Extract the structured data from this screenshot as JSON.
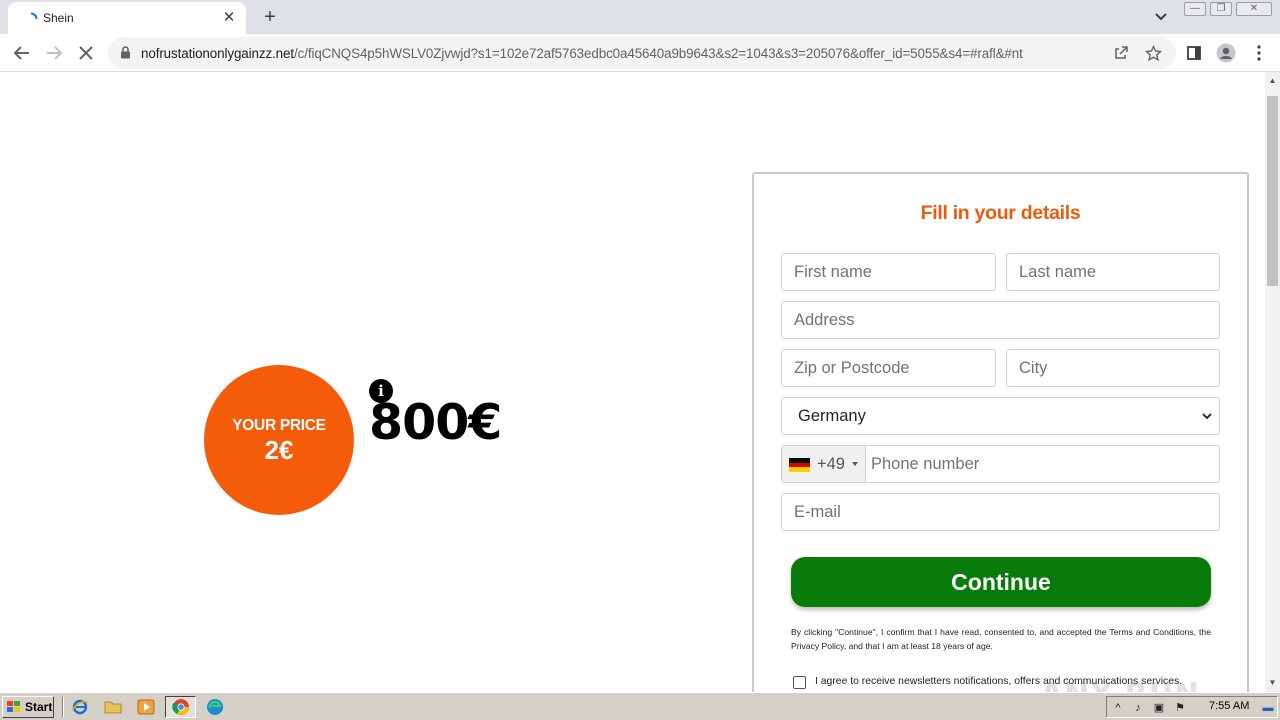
{
  "browser": {
    "tab_title": "Shein",
    "url_host": "nofrustationonlygainzz.net",
    "url_rest": "/c/fiqCNQS4p5hWSLV0Zjvwjd?s1=102e72af5763edbc0a45640a9b9643&s2=1043&s3=205076&offer_id=5055&s4=#rafl&#nt",
    "tab_close_glyph": "✕",
    "new_tab_glyph": "+",
    "win_min": "—",
    "win_restore": "❐",
    "win_close": "✕"
  },
  "offer": {
    "price_label": "YOUR PRICE",
    "price_value": "2€",
    "old_price": "800€",
    "info_glyph": "i"
  },
  "form": {
    "title": "Fill in your details",
    "first_name_placeholder": "First name",
    "last_name_placeholder": "Last name",
    "address_placeholder": "Address",
    "zip_placeholder": "Zip or Postcode",
    "city_placeholder": "City",
    "country_value": "Germany",
    "country_code": "+49",
    "phone_placeholder": "Phone number",
    "email_placeholder": "E-mail",
    "continue_label": "Continue",
    "consent_text": "By clicking \"Continue\", I confirm that I have read, consented to, and accepted the Terms and Conditions, the Privacy Policy, and that I am at least 18 years of age.",
    "newsletter_label": "I agree to receive newsletters notifications, offers and communications services."
  },
  "watermark": "ANY RUN",
  "taskbar": {
    "start_label": "Start",
    "clock": "7:55 AM"
  },
  "colors": {
    "accent_orange": "#f45c0a",
    "title_orange": "#ef5a0a",
    "continue_green": "#087b0a"
  },
  "icons": [
    "chrome-icon",
    "back-icon",
    "forward-icon",
    "stop-icon",
    "lock-icon",
    "share-icon",
    "star-icon",
    "sidepanel-icon",
    "profile-icon",
    "menu-icon",
    "info-icon",
    "germany-flag-icon",
    "ie-icon",
    "folder-icon",
    "media-player-icon",
    "edge-icon"
  ]
}
